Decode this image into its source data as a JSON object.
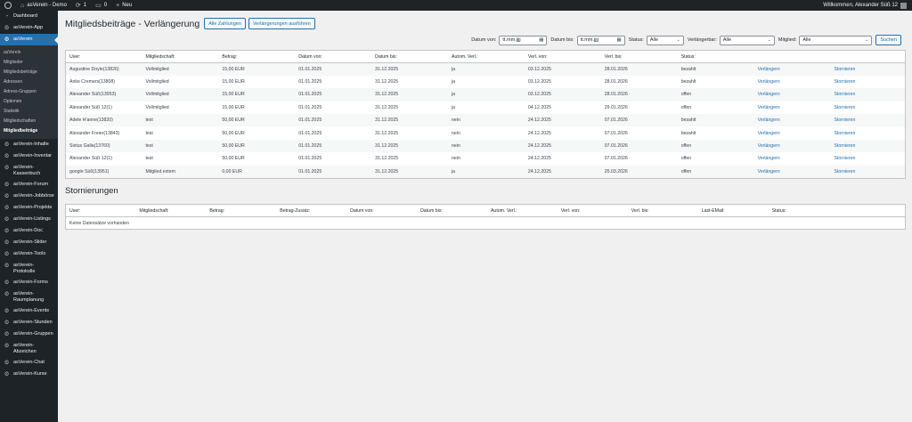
{
  "adminbar": {
    "site_name": "asVerein - Demo",
    "updates_count": "1",
    "comments_count": "0",
    "new_label": "Neu",
    "welcome": "Willkommen, Alexander Süß 12"
  },
  "sidebar": {
    "top_items": [
      {
        "label": "Dashboard",
        "icon": "dashboard-icon"
      },
      {
        "label": "asVerein-App",
        "icon": "gear-icon"
      }
    ],
    "active": {
      "label": "asVerein",
      "icon": "gear-icon"
    },
    "submenu": [
      {
        "label": "asVerein"
      },
      {
        "label": "Mitglieder"
      },
      {
        "label": "Mitgliedsbeiträge"
      },
      {
        "label": "Adressen"
      },
      {
        "label": "Adress-Gruppen"
      },
      {
        "label": "Optionen"
      },
      {
        "label": "Statistik"
      },
      {
        "label": "Mitgliedschaften"
      },
      {
        "label": "Mitgliedbeiträge"
      }
    ],
    "items": [
      {
        "label": "asVerein-Inhalte"
      },
      {
        "label": "asVerein-Inventar"
      },
      {
        "label": "asVerein-Kassenbuch"
      },
      {
        "label": "asVerein-Forum"
      },
      {
        "label": "asVerein-Jobbörse"
      },
      {
        "label": "asVerein-Projekte"
      },
      {
        "label": "asVerein-Listings"
      },
      {
        "label": "asVerein-Doc"
      },
      {
        "label": "asVerein-Slider"
      },
      {
        "label": "asVerein-Tools"
      },
      {
        "label": "asVerein-Protokolle"
      },
      {
        "label": "asVerein-Forms"
      },
      {
        "label": "asVerein-Raumplanung"
      },
      {
        "label": "asVerein-Events"
      },
      {
        "label": "asVerein-Stunden"
      },
      {
        "label": "asVerein-Gruppen"
      },
      {
        "label": "asVerein-Abzeichen"
      },
      {
        "label": "asVerein-Chat"
      },
      {
        "label": "asVerein-Kurse"
      }
    ]
  },
  "page": {
    "title": "Mitgliedsbeiträge - Verlängerung",
    "btn_all_payments": "Alle Zahlungen",
    "btn_run_renewals": "Verlängerungen ausführen"
  },
  "filters": {
    "date_from_label": "Datum von:",
    "date_from_value": "tt.mm.jjjj",
    "date_to_label": "Datum bis:",
    "date_to_value": "tt.mm.jjjj",
    "status_label": "Status:",
    "status_value": "Alle",
    "renewable_label": "Verlängerbar:",
    "renewable_value": "Alle",
    "member_label": "Mitglied:",
    "member_value": "Alle",
    "search_button": "Suchen"
  },
  "renewals": {
    "headers": [
      "User:",
      "Mitgliedschaft:",
      "Betrag:",
      "Datum von:",
      "Datum bis:",
      "Autom. Verl.:",
      "Verl. von:",
      "Verl. bis:",
      "Status:",
      "",
      ""
    ],
    "rows": [
      [
        "Augustine Doyle(13826)",
        "Vollmitglied",
        "15,00 EUR",
        "01.01.2025",
        "31.12.2025",
        "ja",
        "03.12.2025",
        "28.01.2026",
        "bezahlt",
        "Verlängern",
        "Stornieren"
      ],
      [
        "Anke Cremers(13808)",
        "Vollmitglied",
        "15,00 EUR",
        "01.01.2025",
        "31.12.2025",
        "ja",
        "03.12.2025",
        "28.01.2026",
        "bezahlt",
        "Verlängern",
        "Stornieren"
      ],
      [
        "Alexander Süß(13953)",
        "Vollmitglied",
        "15,00 EUR",
        "01.01.2025",
        "31.12.2025",
        "ja",
        "03.12.2025",
        "28.01.2026",
        "offen",
        "Verlängern",
        "Stornieren"
      ],
      [
        "Alexander Süß 12(1)",
        "Vollmitglied",
        "15,00 EUR",
        "01.01.2025",
        "31.12.2025",
        "ja",
        "04.12.2025",
        "29.01.2026",
        "offen",
        "Verlängern",
        "Stornieren"
      ],
      [
        "Adele H'anne(13820)",
        "test",
        "50,00 EUR",
        "01.01.2025",
        "31.12.2025",
        "nein",
        "24.12.2025",
        "07.01.2026",
        "bezahlt",
        "Verlängern",
        "Stornieren"
      ],
      [
        "Alexander Freier(13843)",
        "test",
        "50,00 EUR",
        "01.01.2025",
        "31.12.2025",
        "nein",
        "24.12.2025",
        "07.01.2026",
        "bezahlt",
        "Verlängern",
        "Stornieren"
      ],
      [
        "Sixtus Galla(13760)",
        "test",
        "50,00 EUR",
        "01.01.2025",
        "31.12.2025",
        "nein",
        "24.12.2025",
        "07.01.2026",
        "offen",
        "Verlängern",
        "Stornieren"
      ],
      [
        "Alexander Süß 12(1)",
        "test",
        "50,00 EUR",
        "01.01.2025",
        "31.12.2025",
        "nein",
        "24.12.2025",
        "07.01.2026",
        "offen",
        "Verlängern",
        "Stornieren"
      ],
      [
        "google Süß(13951)",
        "Mitglied extern",
        "0,00 EUR",
        "01.01.2025",
        "31.12.2025",
        "ja",
        "24.12.2025",
        "25.03.2026",
        "offen",
        "Verlängern",
        "Stornieren"
      ]
    ]
  },
  "cancellations": {
    "title": "Stornierungen",
    "headers": [
      "User:",
      "Mitgliedschaft:",
      "Betrag:",
      "Betrag-Zusatz:",
      "Datum von:",
      "Datum bis:",
      "Autom. Verl.:",
      "Verl. von:",
      "Verl. bis:",
      "Last-EMail:",
      "Status:",
      ""
    ],
    "empty": "Keine Datensätze vorhanden"
  }
}
